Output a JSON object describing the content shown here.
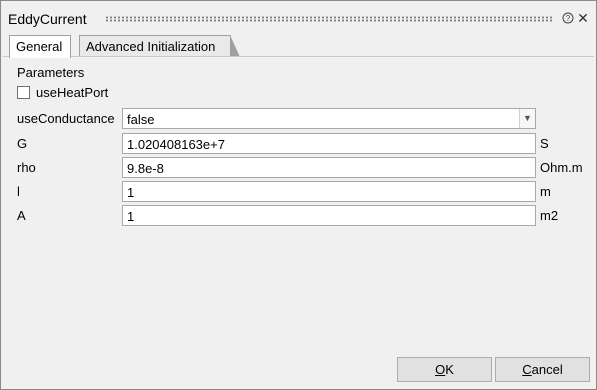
{
  "window": {
    "title": "EddyCurrent",
    "help_glyph": "?",
    "close_glyph": "✕"
  },
  "tabs": [
    {
      "label": "General",
      "active": true
    },
    {
      "label": "Advanced Initialization",
      "active": false
    }
  ],
  "panel": {
    "section_label": "Parameters",
    "use_heat_port": {
      "label": "useHeatPort",
      "checked": false
    },
    "use_conductance": {
      "label": "useConductance",
      "value": "false"
    },
    "params": [
      {
        "label": "G",
        "value": "1.020408163e+7",
        "unit": "S"
      },
      {
        "label": "rho",
        "value": "9.8e-8",
        "unit": "Ohm.m"
      },
      {
        "label": "l",
        "value": "1",
        "unit": "m"
      },
      {
        "label": "A",
        "value": "1",
        "unit": "m2"
      }
    ]
  },
  "buttons": {
    "ok_underlined": "O",
    "ok_rest": "K",
    "cancel_underlined": "C",
    "cancel_rest": "ancel"
  }
}
